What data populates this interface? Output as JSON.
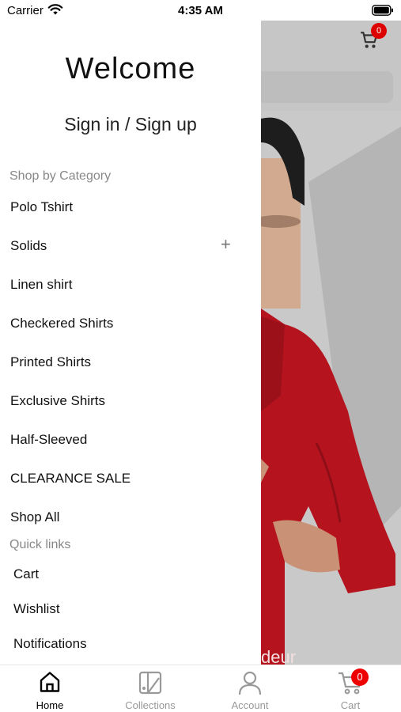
{
  "status_bar": {
    "carrier": "Carrier",
    "time": "4:35 AM"
  },
  "background": {
    "cart_badge": "0",
    "hero_text": "deur"
  },
  "drawer": {
    "welcome": "Welcome",
    "signin": "Sign in / Sign up",
    "category_label": "Shop by Category",
    "categories": [
      "Polo Tshirt",
      "Solids",
      "Linen shirt",
      "Checkered Shirts",
      "Printed Shirts",
      "Exclusive Shirts",
      "Half-Sleeved",
      "CLEARANCE SALE",
      "Shop All"
    ],
    "quick_label": "Quick links",
    "quick_links": [
      "Cart",
      "Wishlist",
      "Notifications"
    ]
  },
  "tabbar": {
    "tabs": [
      {
        "label": "Home",
        "icon": "home-icon",
        "active": true
      },
      {
        "label": "Collections",
        "icon": "collections-icon",
        "active": false
      },
      {
        "label": "Account",
        "icon": "account-icon",
        "active": false
      },
      {
        "label": "Cart",
        "icon": "cart-icon",
        "active": false
      }
    ],
    "cart_badge": "0"
  },
  "colors": {
    "accent_red": "#dd0000",
    "shirt_red": "#b5141f",
    "muted_text": "#888888"
  }
}
